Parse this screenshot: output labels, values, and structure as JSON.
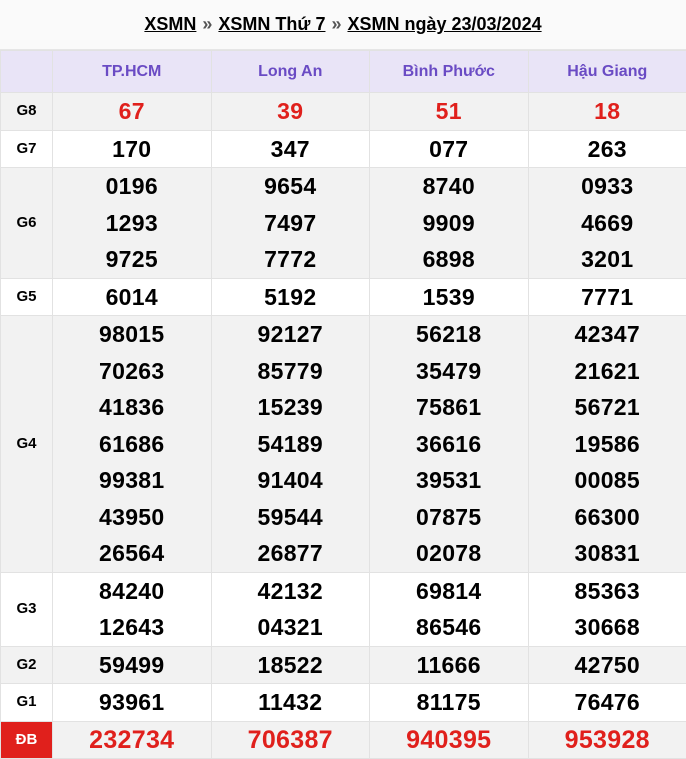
{
  "breadcrumb": {
    "crumb1": "XSMN",
    "crumb2": "XSMN Thứ 7",
    "crumb3": "XSMN ngày 23/03/2024",
    "separator": "»"
  },
  "provinces": [
    "TP.HCM",
    "Long An",
    "Bình Phước",
    "Hậu Giang"
  ],
  "prizes": [
    {
      "label": "G8",
      "highlight": true,
      "results": [
        [
          "67"
        ],
        [
          "39"
        ],
        [
          "51"
        ],
        [
          "18"
        ]
      ]
    },
    {
      "label": "G7",
      "results": [
        [
          "170"
        ],
        [
          "347"
        ],
        [
          "077"
        ],
        [
          "263"
        ]
      ]
    },
    {
      "label": "G6",
      "results": [
        [
          "0196",
          "1293",
          "9725"
        ],
        [
          "9654",
          "7497",
          "7772"
        ],
        [
          "8740",
          "9909",
          "6898"
        ],
        [
          "0933",
          "4669",
          "3201"
        ]
      ]
    },
    {
      "label": "G5",
      "results": [
        [
          "6014"
        ],
        [
          "5192"
        ],
        [
          "1539"
        ],
        [
          "7771"
        ]
      ]
    },
    {
      "label": "G4",
      "results": [
        [
          "98015",
          "70263",
          "41836",
          "61686",
          "99381",
          "43950",
          "26564"
        ],
        [
          "92127",
          "85779",
          "15239",
          "54189",
          "91404",
          "59544",
          "26877"
        ],
        [
          "56218",
          "35479",
          "75861",
          "36616",
          "39531",
          "07875",
          "02078"
        ],
        [
          "42347",
          "21621",
          "56721",
          "19586",
          "00085",
          "66300",
          "30831"
        ]
      ]
    },
    {
      "label": "G3",
      "results": [
        [
          "84240",
          "12643"
        ],
        [
          "42132",
          "04321"
        ],
        [
          "69814",
          "86546"
        ],
        [
          "85363",
          "30668"
        ]
      ]
    },
    {
      "label": "G2",
      "results": [
        [
          "59499"
        ],
        [
          "18522"
        ],
        [
          "11666"
        ],
        [
          "42750"
        ]
      ]
    },
    {
      "label": "G1",
      "results": [
        [
          "93961"
        ],
        [
          "11432"
        ],
        [
          "81175"
        ],
        [
          "76476"
        ]
      ]
    },
    {
      "label": "ĐB",
      "highlight": true,
      "special": true,
      "results": [
        [
          "232734"
        ],
        [
          "706387"
        ],
        [
          "940395"
        ],
        [
          "953928"
        ]
      ]
    }
  ],
  "colors": {
    "header_bg": "#e9e4f7",
    "header_text": "#6a4bc4",
    "highlight_red": "#e0201c",
    "row_shade": "#f2f2f2"
  }
}
